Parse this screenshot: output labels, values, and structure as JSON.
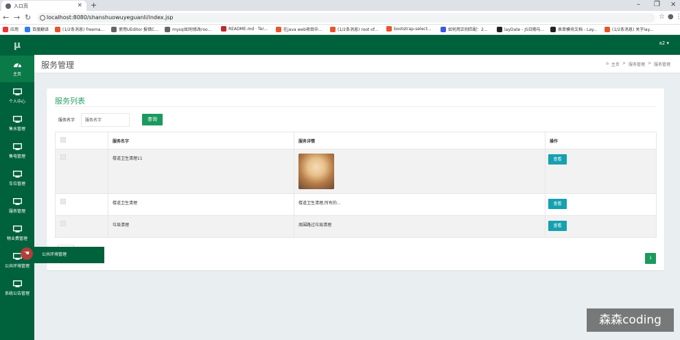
{
  "browser": {
    "tab_title": "入口页",
    "url": "localhost:8080/shanshuowuyeguanli/index.jsp",
    "new_tab": "+",
    "minimize": "–",
    "restore": "❐",
    "close": "×"
  },
  "bookmarks": [
    {
      "label": "应用",
      "color": "#e33"
    },
    {
      "label": "百度翻译",
      "color": "#2a7ff0"
    },
    {
      "label": "(1/2条消息) freema...",
      "color": "#e8542c"
    },
    {
      "label": "使用UEditor 报错C...",
      "color": "#666"
    },
    {
      "label": "mysql如何修改roo...",
      "color": "#666"
    },
    {
      "label": "README.md · Ter...",
      "color": "#c02828"
    },
    {
      "label": "在java web项目中...",
      "color": "#e8542c"
    },
    {
      "label": "(1/2条消息) root of...",
      "color": "#e8542c"
    },
    {
      "label": "bootstrap-select...",
      "color": "#e8542c"
    },
    {
      "label": "如何用正则匹配：2...",
      "color": "#3b5bdb"
    },
    {
      "label": "layDate - JS日期与...",
      "color": "#222"
    },
    {
      "label": "表单模块文档 - Lay...",
      "color": "#222"
    },
    {
      "label": "(1/2条消息) 关于lay...",
      "color": "#e8542c"
    }
  ],
  "app": {
    "logo": "μ",
    "user_menu": "a2 ▾"
  },
  "sidebar": {
    "items": [
      {
        "label": "主页",
        "icon": "dashboard-icon"
      },
      {
        "label": "个人中心",
        "icon": "monitor-icon"
      },
      {
        "label": "售水管理",
        "icon": "monitor-icon"
      },
      {
        "label": "售电管理",
        "icon": "monitor-icon"
      },
      {
        "label": "车位管理",
        "icon": "monitor-icon"
      },
      {
        "label": "服务管理",
        "icon": "monitor-icon"
      },
      {
        "label": "物业费管理",
        "icon": "monitor-icon"
      },
      {
        "label": "公共环境管理",
        "icon": "monitor-icon"
      },
      {
        "label": "系统公告管理",
        "icon": "monitor-icon"
      }
    ],
    "submenu_label": "公共环境管理"
  },
  "header": {
    "title": "服务管理",
    "breadcrumb": [
      "主页",
      "服务管理",
      "服务管理"
    ]
  },
  "card": {
    "title": "服务列表"
  },
  "search": {
    "label": "服务名字",
    "placeholder": "服务名字",
    "button": "查询"
  },
  "table": {
    "headers": [
      "服务名字",
      "服务详情",
      "操作"
    ],
    "rows": [
      {
        "name": "楼道卫生清理11",
        "detail": "",
        "has_image": true,
        "action": "查看"
      },
      {
        "name": "楼道卫生清理",
        "detail": "楼道卫生清理,所有的...",
        "has_image": false,
        "action": "查看"
      },
      {
        "name": "垃圾清理",
        "detail": "周围路过垃圾清理",
        "has_image": false,
        "action": "查看"
      }
    ]
  },
  "pagination": {
    "current": "1"
  },
  "watermark": "森森coding",
  "colors": {
    "sidebar": "#00613d",
    "accent": "#1a9a5e",
    "view_button": "#16a0b0"
  }
}
